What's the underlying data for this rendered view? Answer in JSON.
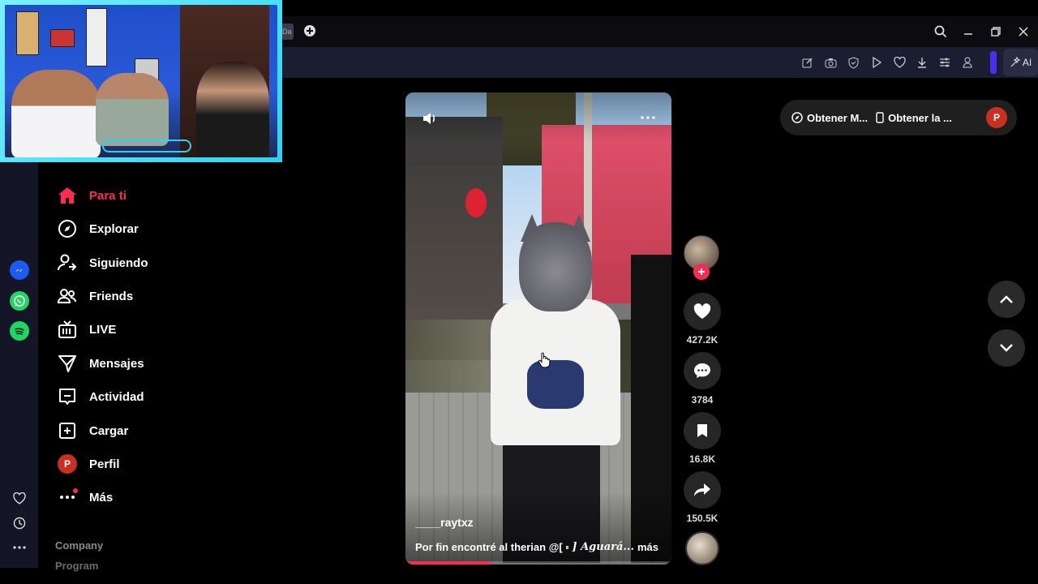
{
  "browser": {
    "tab_fragment": "Da",
    "ai_label": "AI",
    "accent_color": "#4a2df0"
  },
  "sidebar": {
    "items": [
      {
        "label": "Para ti",
        "icon": "home-icon",
        "active": true
      },
      {
        "label": "Explorar",
        "icon": "compass-icon"
      },
      {
        "label": "Siguiendo",
        "icon": "following-icon"
      },
      {
        "label": "Friends",
        "icon": "friends-icon"
      },
      {
        "label": "LIVE",
        "icon": "live-icon"
      },
      {
        "label": "Mensajes",
        "icon": "messages-icon"
      },
      {
        "label": "Actividad",
        "icon": "activity-icon"
      },
      {
        "label": "Cargar",
        "icon": "upload-icon"
      },
      {
        "label": "Perfil",
        "icon": "profile-avatar",
        "avatar_letter": "P"
      },
      {
        "label": "Más",
        "icon": "more-icon"
      }
    ],
    "footer": {
      "company": "Company",
      "program": "Program"
    },
    "active_color": "#fe2c55"
  },
  "video": {
    "username": "____raytxz",
    "caption": "Por fin encontré al therian @[",
    "caption_tail": "] Aguará...",
    "more_label": "más",
    "progress": 0.32
  },
  "actions": {
    "likes": "427.2K",
    "comments": "3784",
    "saves": "16.8K",
    "shares": "150.5K"
  },
  "top_pill": {
    "get_app_label": "Obtener M...",
    "get_desktop_label": "Obtener la ...",
    "avatar_letter": "P"
  }
}
